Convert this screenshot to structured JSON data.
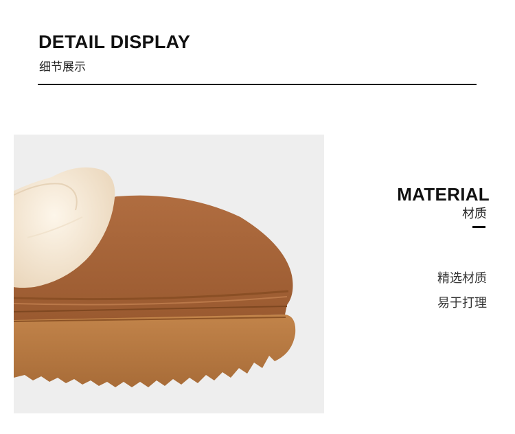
{
  "header": {
    "title_en": "DETAIL DISPLAY",
    "title_cn": "细节展示"
  },
  "material": {
    "title_en": "MATERIAL",
    "title_cn": "材质",
    "features": [
      "精选材质",
      "易于打理"
    ]
  },
  "colors": {
    "background": "#ffffff",
    "photo_background": "#eeeeee",
    "suede": "#a8663a",
    "fur": "#f6ead8",
    "sole": "#b6773f",
    "text": "#111111"
  }
}
